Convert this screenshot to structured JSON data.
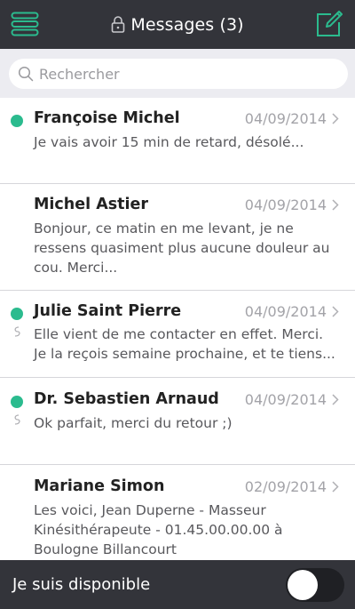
{
  "header": {
    "title": "Messages (3)",
    "accent_color": "#2bbb8e",
    "background": "#33343a"
  },
  "search": {
    "placeholder": "Rechercher"
  },
  "messages": [
    {
      "name": "Françoise Michel",
      "date": "04/09/2014",
      "preview": "Je vais avoir 15 min de retard, désolé...",
      "unread": true,
      "replied": false
    },
    {
      "name": "Michel Astier",
      "date": "04/09/2014",
      "preview": "Bonjour, ce matin en me levant, je ne ressens quasiment plus aucune douleur au cou. Merci...",
      "unread": false,
      "replied": false
    },
    {
      "name": "Julie Saint Pierre",
      "date": "04/09/2014",
      "preview": "Elle vient de me contacter en effet. Merci. Je la reçois semaine prochaine, et te tiens...",
      "unread": true,
      "replied": true
    },
    {
      "name": "Dr. Sebastien Arnaud",
      "date": "04/09/2014",
      "preview": "Ok parfait, merci du retour ;)",
      "unread": true,
      "replied": true
    },
    {
      "name": "Mariane Simon",
      "date": "02/09/2014",
      "preview": "Les voici, Jean Duperne - Masseur Kinésithérapeute - 01.45.00.00.00 à Boulogne Billancourt",
      "unread": false,
      "replied": false
    }
  ],
  "footer": {
    "availability_label": "Je suis disponible",
    "availability_on": false
  }
}
